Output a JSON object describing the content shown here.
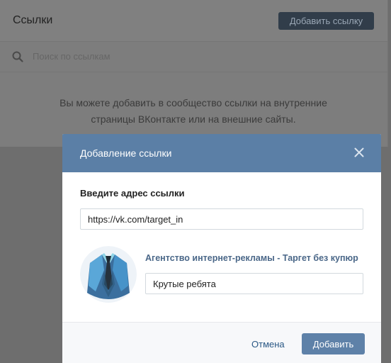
{
  "page": {
    "title": "Ссылки",
    "add_link_label": "Добавить ссылку",
    "search_placeholder": "Поиск по ссылкам",
    "empty_line1": "Вы можете добавить в сообщество ссылки на внутренние",
    "empty_line2": "страницы ВКонтакте или на внешние сайты."
  },
  "modal": {
    "title": "Добавление ссылки",
    "field_label": "Введите адрес ссылки",
    "url_value": "https://vk.com/target_in",
    "link_title": "Агентство интернет-рекламы - Таргет без купюр",
    "description_value": "Крутые ребята",
    "cancel_label": "Отмена",
    "add_label": "Добавить"
  },
  "colors": {
    "header": "#5b7fa6",
    "primary_button": "#5e81a8",
    "link": "#4a6788"
  },
  "icons": {
    "search": "search-icon",
    "close": "close-icon",
    "avatar": "suit-avatar-icon"
  }
}
